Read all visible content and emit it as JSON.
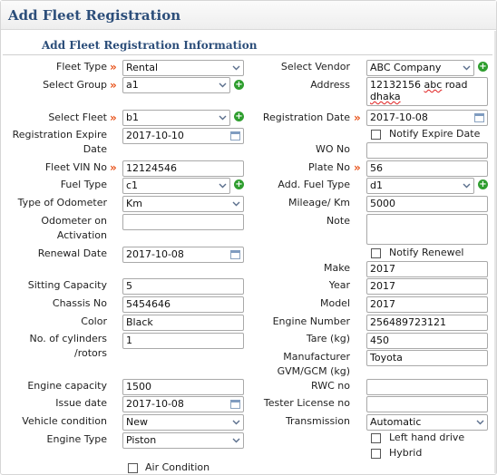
{
  "page": {
    "title": "Add Fleet Registration",
    "section_title": "Add Fleet Registration Information"
  },
  "left": {
    "fleet_type": {
      "label": "Fleet Type",
      "value": "Rental"
    },
    "select_group": {
      "label": "Select Group",
      "value": "a1"
    },
    "select_fleet": {
      "label": "Select Fleet",
      "value": "b1"
    },
    "registration_expire_date": {
      "label_line1": "Registration Expire",
      "label_line2": "Date",
      "value": "2017-10-10"
    },
    "fleet_vin_no": {
      "label": "Fleet VIN No",
      "value": "12124546"
    },
    "fuel_type": {
      "label": "Fuel Type",
      "value": "c1"
    },
    "type_of_odometer": {
      "label": "Type of Odometer",
      "value": "Km"
    },
    "odometer_on_activation": {
      "label_line1": "Odometer on",
      "label_line2": "Activation",
      "value": ""
    },
    "renewal_date": {
      "label": "Renewal Date",
      "value": "2017-10-08"
    },
    "sitting_capacity": {
      "label": "Sitting Capacity",
      "value": "5"
    },
    "chassis_no": {
      "label": "Chassis No",
      "value": "5454646"
    },
    "color": {
      "label": "Color",
      "value": "Black"
    },
    "no_of_cylinders": {
      "label_line1": "No. of cylinders",
      "label_line2": "/rotors",
      "value": "1"
    },
    "engine_capacity": {
      "label": "Engine capacity",
      "value": "1500"
    },
    "issue_date": {
      "label": "Issue date",
      "value": "2017-10-08"
    },
    "vehicle_condition": {
      "label": "Vehicle condition",
      "value": "New"
    },
    "engine_type": {
      "label": "Engine Type",
      "value": "Piston"
    },
    "air_condition": {
      "label": "Air Condition"
    }
  },
  "right": {
    "select_vendor": {
      "label": "Select Vendor",
      "value": "ABC Company"
    },
    "address": {
      "label": "Address",
      "line1_a": "12132156 ",
      "line1_b": "abc",
      "line1_c": " road",
      "line2": "dhaka"
    },
    "registration_date": {
      "label": "Registration Date",
      "value": "2017-10-08"
    },
    "notify_expire_date": {
      "label": "Notify Expire Date"
    },
    "wo_no": {
      "label": "WO No",
      "value": ""
    },
    "plate_no": {
      "label": "Plate No",
      "value": "56"
    },
    "add_fuel_type": {
      "label": "Add. Fuel Type",
      "value": "d1"
    },
    "mileage": {
      "label": "Mileage/ Km",
      "value": "5000"
    },
    "note": {
      "label": "Note",
      "value": ""
    },
    "notify_renewel": {
      "label": "Notify Renewel"
    },
    "make": {
      "label": "Make",
      "value": "2017"
    },
    "year": {
      "label": "Year",
      "value": "2017"
    },
    "model": {
      "label": "Model",
      "value": "2017"
    },
    "engine_number": {
      "label": "Engine Number",
      "value": "256489723121"
    },
    "tare": {
      "label": "Tare (kg)",
      "value": "450"
    },
    "manufacturer_gvm": {
      "label_line1": "Manufacturer",
      "label_line2": "GVM/GCM (kg)",
      "value": "Toyota"
    },
    "rwc_no": {
      "label": "RWC no",
      "value": ""
    },
    "tester_license_no": {
      "label": "Tester License no",
      "value": ""
    },
    "transmission": {
      "label": "Transmission",
      "value": "Automatic"
    },
    "left_hand_drive": {
      "label": "Left hand drive"
    },
    "hybrid": {
      "label": "Hybrid"
    }
  },
  "symbols": {
    "required_marker": "»",
    "add_icon": "+",
    "dropdown_icon": "chevron-down-icon",
    "calendar_icon": "calendar-icon"
  },
  "colors": {
    "title": "#2c4e7a",
    "required": "#e8531b",
    "add_icon": "#2f9e2f"
  }
}
